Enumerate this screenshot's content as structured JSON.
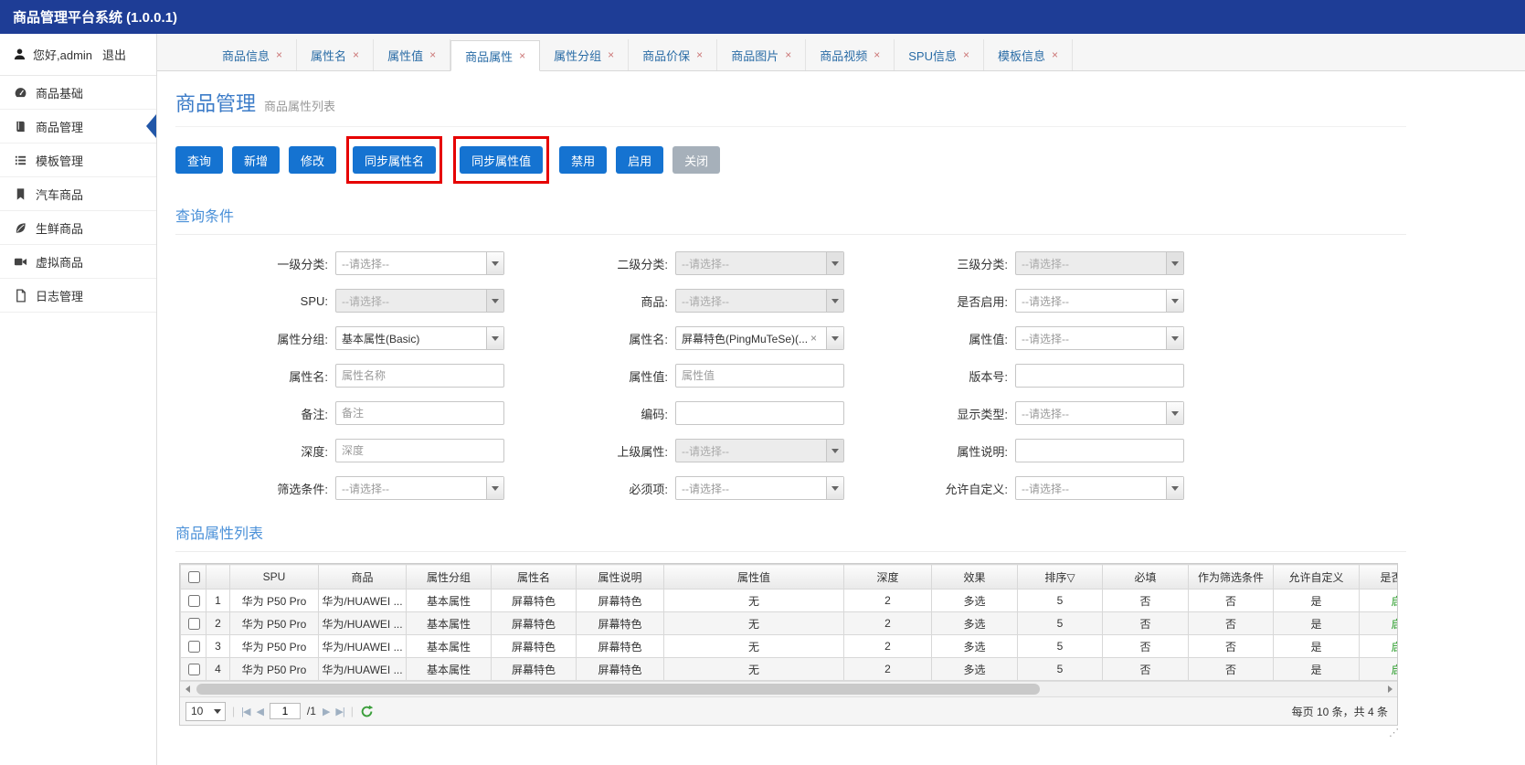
{
  "app": {
    "title": "商品管理平台系统 (1.0.0.1)"
  },
  "icons": {
    "tab_close": "×"
  },
  "sidebar": {
    "user": {
      "greeting": "您好,admin",
      "logout": "退出"
    },
    "items": [
      {
        "id": "goods-base",
        "label": "商品基础",
        "icon": "dashboard-icon",
        "active": false
      },
      {
        "id": "goods-manage",
        "label": "商品管理",
        "icon": "book-icon",
        "active": true
      },
      {
        "id": "template-manage",
        "label": "模板管理",
        "icon": "list-icon",
        "active": false
      },
      {
        "id": "car-goods",
        "label": "汽车商品",
        "icon": "bookmark-icon",
        "active": false
      },
      {
        "id": "fresh-goods",
        "label": "生鲜商品",
        "icon": "leaf-icon",
        "active": false
      },
      {
        "id": "virtual-goods",
        "label": "虚拟商品",
        "icon": "video-camera-icon",
        "active": false
      },
      {
        "id": "log-manage",
        "label": "日志管理",
        "icon": "file-icon",
        "active": false
      }
    ]
  },
  "tabs": [
    {
      "id": "goods-info",
      "label": "商品信息",
      "active": false
    },
    {
      "id": "attr-name",
      "label": "属性名",
      "active": false
    },
    {
      "id": "attr-value",
      "label": "属性值",
      "active": false
    },
    {
      "id": "goods-attr",
      "label": "商品属性",
      "active": true
    },
    {
      "id": "attr-group",
      "label": "属性分组",
      "active": false
    },
    {
      "id": "price-guard",
      "label": "商品价保",
      "active": false
    },
    {
      "id": "goods-image",
      "label": "商品图片",
      "active": false
    },
    {
      "id": "goods-video",
      "label": "商品视频",
      "active": false
    },
    {
      "id": "spu-info",
      "label": "SPU信息",
      "active": false
    },
    {
      "id": "template-info",
      "label": "模板信息",
      "active": false
    }
  ],
  "page": {
    "title": "商品管理",
    "subtitle": "商品属性列表"
  },
  "toolbar": [
    {
      "name": "query-button",
      "label": "查询",
      "style": "primary",
      "annotated": false
    },
    {
      "name": "add-button",
      "label": "新增",
      "style": "primary",
      "annotated": false
    },
    {
      "name": "edit-button",
      "label": "修改",
      "style": "primary",
      "annotated": false
    },
    {
      "name": "sync-attr-name-button",
      "label": "同步属性名",
      "style": "primary",
      "annotated": true
    },
    {
      "name": "sync-attr-value-button",
      "label": "同步属性值",
      "style": "primary",
      "annotated": true
    },
    {
      "name": "disable-button",
      "label": "禁用",
      "style": "primary",
      "annotated": false
    },
    {
      "name": "enable-button",
      "label": "启用",
      "style": "primary",
      "annotated": false
    },
    {
      "name": "close-button",
      "label": "关闭",
      "style": "muted",
      "annotated": false
    }
  ],
  "annotation_color": "#e60000",
  "query": {
    "title": "查询条件",
    "fields": [
      {
        "id": "level1-category",
        "label": "一级分类:",
        "type": "select",
        "placeholder": "--请选择--",
        "disabled": false
      },
      {
        "id": "level2-category",
        "label": "二级分类:",
        "type": "select",
        "placeholder": "--请选择--",
        "disabled": true
      },
      {
        "id": "level3-category",
        "label": "三级分类:",
        "type": "select",
        "placeholder": "--请选择--",
        "disabled": true
      },
      {
        "id": "spu",
        "label": "SPU:",
        "type": "select",
        "placeholder": "--请选择--",
        "disabled": true
      },
      {
        "id": "goods",
        "label": "商品:",
        "type": "select",
        "placeholder": "--请选择--",
        "disabled": true
      },
      {
        "id": "is-enabled",
        "label": "是否启用:",
        "type": "select",
        "placeholder": "--请选择--",
        "disabled": false
      },
      {
        "id": "attr-group",
        "label": "属性分组:",
        "type": "select",
        "value": "基本属性(Basic)",
        "disabled": false
      },
      {
        "id": "attr-name-combo",
        "label": "属性名:",
        "type": "multiselect",
        "tag": "屏幕特色(PingMuTeSe)(...",
        "tag_close": "×",
        "disabled": false
      },
      {
        "id": "attr-value-combo",
        "label": "属性值:",
        "type": "select",
        "placeholder": "--请选择--",
        "disabled": false
      },
      {
        "id": "attr-name-text",
        "label": "属性名:",
        "type": "text",
        "placeholder": "属性名称"
      },
      {
        "id": "attr-value-text",
        "label": "属性值:",
        "type": "text",
        "placeholder": "属性值"
      },
      {
        "id": "version",
        "label": "版本号:",
        "type": "text",
        "placeholder": ""
      },
      {
        "id": "remark",
        "label": "备注:",
        "type": "text",
        "placeholder": "备注"
      },
      {
        "id": "code",
        "label": "编码:",
        "type": "text",
        "placeholder": ""
      },
      {
        "id": "display-type",
        "label": "显示类型:",
        "type": "select",
        "placeholder": "--请选择--",
        "disabled": false
      },
      {
        "id": "depth",
        "label": "深度:",
        "type": "text",
        "placeholder": "深度"
      },
      {
        "id": "parent-attr",
        "label": "上级属性:",
        "type": "select",
        "placeholder": "--请选择--",
        "disabled": true
      },
      {
        "id": "attr-desc",
        "label": "属性说明:",
        "type": "text",
        "placeholder": ""
      },
      {
        "id": "filter-cond",
        "label": "筛选条件:",
        "type": "select",
        "placeholder": "--请选择--",
        "disabled": false
      },
      {
        "id": "required",
        "label": "必须项:",
        "type": "select",
        "placeholder": "--请选择--",
        "disabled": false
      },
      {
        "id": "allow-custom",
        "label": "允许自定义:",
        "type": "select",
        "placeholder": "--请选择--",
        "disabled": false
      }
    ]
  },
  "grid": {
    "title": "商品属性列表",
    "columns": [
      "SPU",
      "商品",
      "属性分组",
      "属性名",
      "属性说明",
      "属性值",
      "深度",
      "效果",
      "排序▽",
      "必填",
      "作为筛选条件",
      "允许自定义",
      "是否启用"
    ],
    "rows": [
      {
        "num": "1",
        "cells": [
          "华为 P50 Pro",
          "华为/HUAWEI ...",
          "基本属性",
          "屏幕特色",
          "屏幕特色",
          "无",
          "2",
          "多选",
          "5",
          "否",
          "否",
          "是",
          "启用"
        ]
      },
      {
        "num": "2",
        "cells": [
          "华为 P50 Pro",
          "华为/HUAWEI ...",
          "基本属性",
          "屏幕特色",
          "屏幕特色",
          "无",
          "2",
          "多选",
          "5",
          "否",
          "否",
          "是",
          "启用"
        ]
      },
      {
        "num": "3",
        "cells": [
          "华为 P50 Pro",
          "华为/HUAWEI ...",
          "基本属性",
          "屏幕特色",
          "屏幕特色",
          "无",
          "2",
          "多选",
          "5",
          "否",
          "否",
          "是",
          "启用"
        ]
      },
      {
        "num": "4",
        "cells": [
          "华为 P50 Pro",
          "华为/HUAWEI ...",
          "基本属性",
          "屏幕特色",
          "屏幕特色",
          "无",
          "2",
          "多选",
          "5",
          "否",
          "否",
          "是",
          "启用"
        ]
      }
    ],
    "enabled_color": "#2e9e2e"
  },
  "pager": {
    "page_size": "10",
    "page": "1",
    "total_pages": "/1",
    "summary": "每页 10 条，共 4 条"
  }
}
